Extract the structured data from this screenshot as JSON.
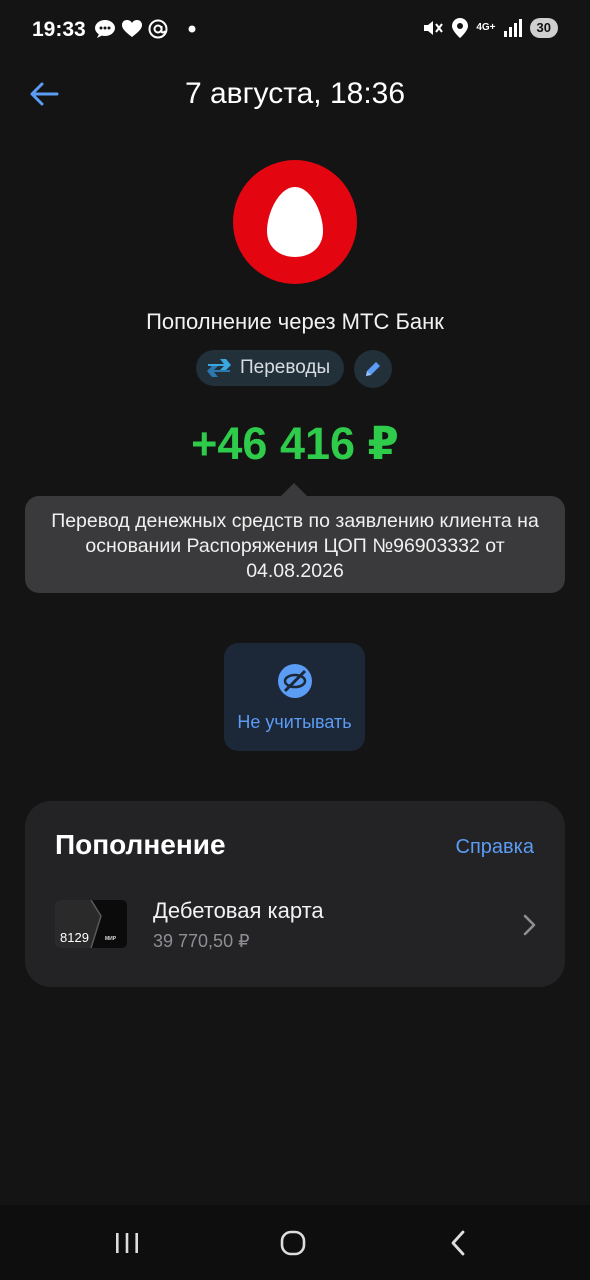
{
  "status_bar": {
    "time": "19:33",
    "network": "4G+",
    "battery": "30",
    "left_icons": [
      "chat-bubble-icon",
      "heart-icon",
      "at-sign-icon",
      "dot-icon"
    ],
    "right_icons": [
      "mute-icon",
      "location-icon",
      "signal-icon"
    ]
  },
  "header": {
    "title": "7 августа, 18:36"
  },
  "transaction": {
    "merchant": "Пополнение через МТС Банк",
    "category": "Переводы",
    "amount": "+46 416 ₽",
    "description": "Перевод денежных средств по заявлению клиента на основании Распоряжения ЦОП №96903332 от 04.08.2026",
    "amount_color": "#2fcb4a",
    "logo_color": "#e30611"
  },
  "actions": {
    "ignore_label": "Не учитывать"
  },
  "details": {
    "title": "Пополнение",
    "help_label": "Справка",
    "account": {
      "card_last4": "8129",
      "card_brand": "МИР",
      "name": "Дебетовая карта",
      "balance": "39 770,50 ₽"
    }
  },
  "colors": {
    "accent": "#5b9cf5",
    "background": "#141414"
  }
}
